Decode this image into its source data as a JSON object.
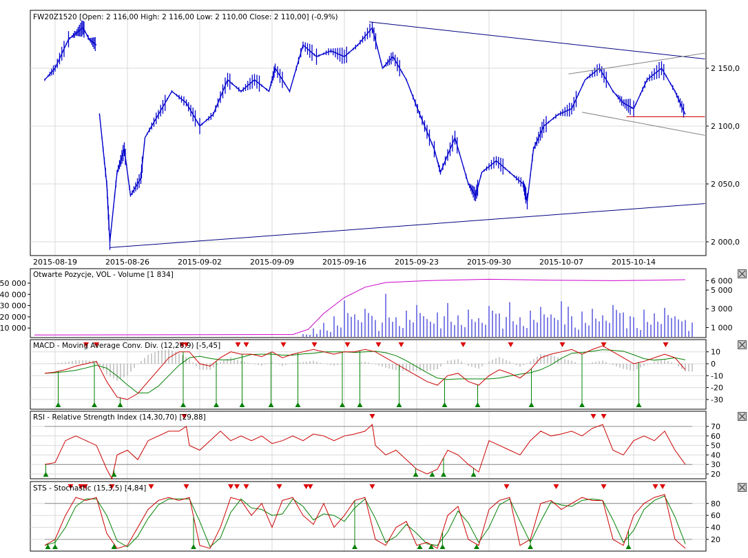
{
  "colors": {
    "price": "#0000cc",
    "trend": "#000080",
    "trend_gray": "#808080",
    "support": "#cc0000",
    "macd": "#cc0000",
    "signal": "#008000",
    "hist": "#999999",
    "volume": "#0000cc",
    "oi": "#cc00cc",
    "rsi": "#cc0000",
    "sts": "#cc0000",
    "sts_signal": "#008000",
    "up_marker": "#008000",
    "down_marker": "#dd0000",
    "grid": "#d8d8d8"
  },
  "chart_data": [
    {
      "type": "line",
      "title": "FW20Z1520 [Open: 2 116,00  High: 2 116,00  Low: 2 110,00  Close: 2 110,00] (-0,9%)",
      "x_unit": "days since 2015-08-19",
      "xlim": [
        -2.4,
        62.9
      ],
      "ylim": [
        1992,
        2200
      ],
      "x_tick_labels": [
        "2015-08-19",
        "2015-08-26",
        "2015-09-02",
        "2015-09-09",
        "2015-09-16",
        "2015-09-23",
        "2015-09-30",
        "2015-10-07",
        "2015-10-14"
      ],
      "x_ticks": [
        0,
        7,
        14,
        21,
        28,
        35,
        42,
        49,
        56
      ],
      "y_ticks": [
        2000,
        2050,
        2100,
        2150
      ],
      "y_tick_labels": [
        "2 000,0",
        "2 050,0",
        "2 100,0",
        "2 150,0"
      ],
      "segments": [
        [
          [
            -1,
            2140
          ],
          [
            0,
            2150
          ],
          [
            1.3,
            2175
          ],
          [
            2,
            2180
          ],
          [
            2.7,
            2185
          ],
          [
            3.3,
            2175
          ],
          [
            4,
            2170
          ]
        ],
        [
          [
            4.3,
            2110
          ],
          [
            5,
            2050
          ],
          [
            5.3,
            2000
          ],
          [
            6,
            2060
          ],
          [
            6.7,
            2080
          ],
          [
            7.3,
            2040
          ],
          [
            8.3,
            2055
          ],
          [
            8.7,
            2090
          ],
          [
            10,
            2110
          ],
          [
            11.3,
            2130
          ],
          [
            12.7,
            2120
          ],
          [
            14,
            2100
          ],
          [
            15.3,
            2110
          ],
          [
            16.7,
            2140
          ],
          [
            18,
            2130
          ],
          [
            19.3,
            2140
          ],
          [
            20.7,
            2130
          ],
          [
            21.3,
            2150
          ],
          [
            22.7,
            2130
          ],
          [
            24,
            2170
          ],
          [
            25.3,
            2160
          ],
          [
            26.7,
            2165
          ],
          [
            28,
            2160
          ],
          [
            29.3,
            2170
          ],
          [
            30.7,
            2185
          ],
          [
            31.7,
            2150
          ],
          [
            32.7,
            2160
          ],
          [
            34,
            2140
          ],
          [
            35.3,
            2110
          ],
          [
            36.7,
            2080
          ],
          [
            37.3,
            2060
          ],
          [
            38.7,
            2090
          ],
          [
            40,
            2050
          ],
          [
            40.7,
            2040
          ],
          [
            41.3,
            2060
          ],
          [
            42.7,
            2070
          ],
          [
            44,
            2060
          ],
          [
            45.3,
            2050
          ],
          [
            45.7,
            2035
          ],
          [
            46.3,
            2080
          ],
          [
            47.3,
            2100
          ],
          [
            48.7,
            2110
          ],
          [
            50,
            2115
          ],
          [
            51.3,
            2140
          ],
          [
            52.7,
            2150
          ],
          [
            54,
            2130
          ],
          [
            55,
            2120
          ],
          [
            56,
            2115
          ],
          [
            57.3,
            2140
          ],
          [
            58.7,
            2150
          ],
          [
            60,
            2130
          ],
          [
            61,
            2110
          ]
        ]
      ],
      "trendlines": [
        {
          "kind": "resistance",
          "from": [
            30.4,
            2190
          ],
          "to": [
            62.9,
            2158
          ]
        },
        {
          "kind": "support",
          "from": [
            5.3,
            1995
          ],
          "to": [
            62.9,
            2033
          ]
        },
        {
          "kind": "channel-upper",
          "from": [
            49.7,
            2145
          ],
          "to": [
            62.9,
            2163
          ]
        },
        {
          "kind": "channel-lower",
          "from": [
            51,
            2112
          ],
          "to": [
            62.9,
            2092
          ]
        },
        {
          "kind": "horizontal",
          "from": [
            55.3,
            2108
          ],
          "to": [
            62.9,
            2108
          ]
        }
      ]
    },
    {
      "type": "bar",
      "title": "Otwarte Pozycje, VOL - Volume [1 834]",
      "left_ticks": [
        "50 000",
        "40 000",
        "30 000",
        "20 000",
        "10 000"
      ],
      "right_ticks": [
        "6 000",
        "5 000",
        "3 000",
        "1 000"
      ],
      "right_tick_values": [
        6000,
        5000,
        3000,
        1000
      ],
      "volume_start": 24,
      "volume": [
        300,
        900,
        1500,
        2200,
        3900,
        2400,
        3000,
        1800,
        4600,
        2100,
        2800,
        3400,
        1900,
        2600,
        3600,
        2300,
        2900,
        2000,
        3300,
        2500,
        3700,
        2100,
        2800,
        3200,
        2400,
        3800,
        2200,
        2700,
        3000,
        2300,
        3400,
        2600,
        2100,
        2900,
        2500,
        3100,
        2200,
        1800
      ],
      "open_interest": [
        [
          -2,
          200
        ],
        [
          23,
          250
        ],
        [
          24.5,
          800
        ],
        [
          26,
          2500
        ],
        [
          28,
          4200
        ],
        [
          30,
          5300
        ],
        [
          32,
          5800
        ],
        [
          36,
          6000
        ],
        [
          42,
          6150
        ],
        [
          48,
          6050
        ],
        [
          54,
          6000
        ],
        [
          58,
          6050
        ],
        [
          61,
          6100
        ]
      ]
    },
    {
      "type": "line",
      "title": "MACD - Moving Average Conv. Div. (12,26,9) [-5,45]",
      "y_ticks": [
        10,
        0,
        -10,
        -20,
        -30
      ],
      "macd": [
        [
          -1,
          -8
        ],
        [
          0,
          -7
        ],
        [
          1,
          -5
        ],
        [
          2,
          -2
        ],
        [
          3,
          0
        ],
        [
          4,
          2
        ],
        [
          5,
          -15
        ],
        [
          6,
          -28
        ],
        [
          7,
          -30
        ],
        [
          8,
          -25
        ],
        [
          9,
          -15
        ],
        [
          10,
          -5
        ],
        [
          11,
          5
        ],
        [
          12,
          10
        ],
        [
          13,
          10
        ],
        [
          14,
          0
        ],
        [
          15,
          -2
        ],
        [
          16,
          5
        ],
        [
          17,
          10
        ],
        [
          18,
          8
        ],
        [
          19,
          8
        ],
        [
          20,
          6
        ],
        [
          21,
          10
        ],
        [
          22,
          5
        ],
        [
          23,
          8
        ],
        [
          24,
          10
        ],
        [
          25,
          12
        ],
        [
          26,
          10
        ],
        [
          27,
          8
        ],
        [
          28,
          10
        ],
        [
          29,
          10
        ],
        [
          30,
          12
        ],
        [
          31,
          10
        ],
        [
          32,
          5
        ],
        [
          33,
          0
        ],
        [
          34,
          -5
        ],
        [
          35,
          -10
        ],
        [
          36,
          -15
        ],
        [
          37,
          -18
        ],
        [
          38,
          -10
        ],
        [
          39,
          -8
        ],
        [
          40,
          -15
        ],
        [
          41,
          -18
        ],
        [
          42,
          -10
        ],
        [
          43,
          -5
        ],
        [
          44,
          -8
        ],
        [
          45,
          -12
        ],
        [
          46,
          -5
        ],
        [
          47,
          5
        ],
        [
          48,
          8
        ],
        [
          49,
          10
        ],
        [
          50,
          12
        ],
        [
          51,
          8
        ],
        [
          52,
          12
        ],
        [
          53,
          15
        ],
        [
          54,
          10
        ],
        [
          55,
          5
        ],
        [
          56,
          0
        ],
        [
          57,
          2
        ],
        [
          58,
          5
        ],
        [
          59,
          8
        ],
        [
          60,
          5
        ],
        [
          61,
          -5
        ]
      ],
      "sell_signals": [
        3,
        4,
        12.3,
        12.7,
        17.7,
        18.5,
        22.1,
        25.1,
        28.3,
        31.3,
        33.5,
        39.5,
        44.1,
        49.1,
        53.1,
        59.1
      ],
      "buy_signals": [
        0.3,
        3.8,
        6.3,
        12.4,
        15.6,
        18.1,
        20.9,
        23.5,
        27.8,
        29.5,
        33.3,
        37.7,
        40.9,
        46.1,
        51,
        56.5
      ]
    },
    {
      "type": "line",
      "title": "RSI - Relative Strength Index (14,30,70) [29,88]",
      "y_ticks": [
        70,
        60,
        50,
        40,
        30,
        20
      ],
      "levels": [
        70,
        30
      ],
      "rsi": [
        [
          -1,
          30
        ],
        [
          0,
          32
        ],
        [
          1,
          55
        ],
        [
          2,
          60
        ],
        [
          3,
          55
        ],
        [
          4,
          50
        ],
        [
          5,
          25
        ],
        [
          5.5,
          15
        ],
        [
          6,
          40
        ],
        [
          7,
          45
        ],
        [
          8,
          35
        ],
        [
          9,
          55
        ],
        [
          10,
          60
        ],
        [
          11,
          65
        ],
        [
          12,
          65
        ],
        [
          12.7,
          70
        ],
        [
          13,
          50
        ],
        [
          14,
          45
        ],
        [
          15,
          55
        ],
        [
          16,
          65
        ],
        [
          17,
          55
        ],
        [
          18,
          60
        ],
        [
          19,
          55
        ],
        [
          20,
          60
        ],
        [
          21,
          52
        ],
        [
          22,
          55
        ],
        [
          23,
          60
        ],
        [
          24,
          55
        ],
        [
          25,
          62
        ],
        [
          26,
          60
        ],
        [
          27,
          55
        ],
        [
          28,
          60
        ],
        [
          29,
          62
        ],
        [
          30,
          65
        ],
        [
          30.7,
          72
        ],
        [
          31,
          50
        ],
        [
          32,
          40
        ],
        [
          33,
          45
        ],
        [
          34,
          35
        ],
        [
          35,
          25
        ],
        [
          36,
          20
        ],
        [
          37,
          25
        ],
        [
          38,
          45
        ],
        [
          39,
          40
        ],
        [
          40,
          30
        ],
        [
          41,
          22
        ],
        [
          42,
          55
        ],
        [
          43,
          50
        ],
        [
          44,
          45
        ],
        [
          45,
          40
        ],
        [
          46,
          55
        ],
        [
          47,
          65
        ],
        [
          48,
          60
        ],
        [
          49,
          62
        ],
        [
          50,
          65
        ],
        [
          51,
          60
        ],
        [
          52,
          68
        ],
        [
          53,
          72
        ],
        [
          54,
          45
        ],
        [
          55,
          40
        ],
        [
          56,
          55
        ],
        [
          57,
          60
        ],
        [
          58,
          55
        ],
        [
          59,
          65
        ],
        [
          60,
          45
        ],
        [
          61,
          30
        ]
      ],
      "sell_signals": [
        12.5,
        30.7,
        52.1,
        53.1
      ],
      "buy_signals": [
        -0.9,
        5.7,
        34.9,
        36.5,
        37.6,
        40.5
      ]
    },
    {
      "type": "line",
      "title": "STS - Stochastic (15,3,5) [4,84]",
      "y_ticks": [
        80,
        60,
        40,
        20
      ],
      "levels": [
        80,
        20
      ],
      "k": [
        [
          -1,
          10
        ],
        [
          0,
          20
        ],
        [
          1,
          60
        ],
        [
          2,
          90
        ],
        [
          3,
          85
        ],
        [
          4,
          90
        ],
        [
          5,
          30
        ],
        [
          6,
          5
        ],
        [
          7,
          10
        ],
        [
          8,
          40
        ],
        [
          9,
          70
        ],
        [
          10,
          85
        ],
        [
          11,
          90
        ],
        [
          12,
          85
        ],
        [
          13,
          90
        ],
        [
          14,
          10
        ],
        [
          15,
          5
        ],
        [
          16,
          40
        ],
        [
          17,
          90
        ],
        [
          18,
          85
        ],
        [
          19,
          60
        ],
        [
          20,
          80
        ],
        [
          21,
          40
        ],
        [
          22,
          85
        ],
        [
          23,
          90
        ],
        [
          24,
          60
        ],
        [
          25,
          45
        ],
        [
          26,
          80
        ],
        [
          27,
          40
        ],
        [
          28,
          60
        ],
        [
          29,
          85
        ],
        [
          30,
          90
        ],
        [
          31,
          20
        ],
        [
          32,
          10
        ],
        [
          33,
          40
        ],
        [
          34,
          50
        ],
        [
          35,
          10
        ],
        [
          36,
          15
        ],
        [
          37,
          5
        ],
        [
          38,
          60
        ],
        [
          39,
          75
        ],
        [
          40,
          20
        ],
        [
          41,
          10
        ],
        [
          42,
          70
        ],
        [
          43,
          85
        ],
        [
          44,
          90
        ],
        [
          45,
          10
        ],
        [
          46,
          20
        ],
        [
          47,
          80
        ],
        [
          48,
          85
        ],
        [
          49,
          70
        ],
        [
          50,
          80
        ],
        [
          51,
          90
        ],
        [
          52,
          85
        ],
        [
          53,
          85
        ],
        [
          54,
          20
        ],
        [
          55,
          10
        ],
        [
          56,
          60
        ],
        [
          57,
          80
        ],
        [
          58,
          90
        ],
        [
          59,
          95
        ],
        [
          60,
          20
        ],
        [
          61,
          5
        ]
      ],
      "sell_signals": [
        1.5,
        2.5,
        2.9,
        5.5,
        9.3,
        12.7,
        17,
        17.6,
        18.5,
        21.7,
        24.3,
        24.7,
        30.7,
        43.7,
        48.5,
        53.1,
        58.1,
        58.8
      ],
      "buy_signals": [
        -0.7,
        0,
        5.7,
        13.4,
        29,
        35.3,
        36.4,
        37.5,
        40.8,
        46,
        55.5
      ]
    }
  ],
  "close_buttons": [
    "close-volume",
    "close-macd",
    "close-rsi",
    "close-sts"
  ]
}
